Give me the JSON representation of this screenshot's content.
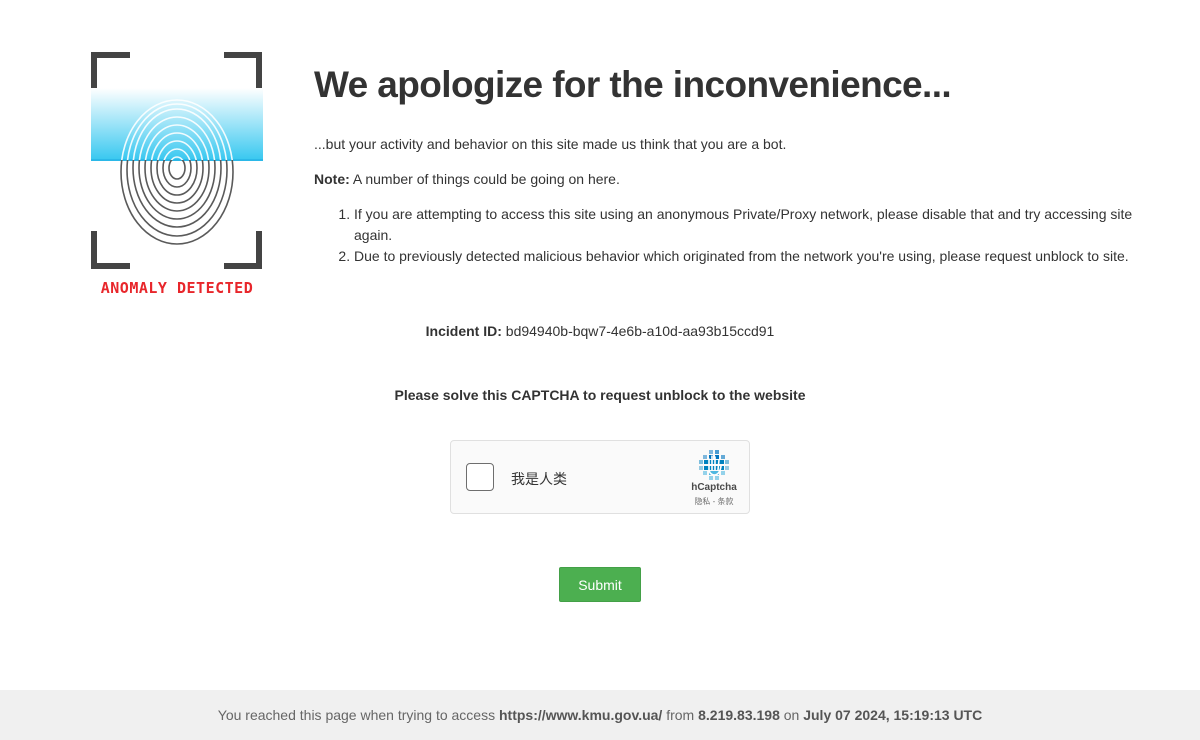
{
  "logo": {
    "caption": "ANOMALY DETECTED",
    "icon": "fingerprint-scan-icon",
    "caption_color": "#e8262b",
    "scan_color": "#38c8f0"
  },
  "heading": "We apologize for the inconvenience...",
  "lead": "...but your activity and behavior on this site made us think that you are a bot.",
  "note": {
    "label": "Note:",
    "text": " A number of things could be going on here."
  },
  "reasons": [
    "If you are attempting to access this site using an anonymous Private/Proxy network, please disable that and try accessing site again.",
    "Due to previously detected malicious behavior which originated from the network you're using, please request unblock to site."
  ],
  "incident": {
    "label": "Incident ID:",
    "value": " bd94940b-bqw7-4e6b-a10d-aa93b15ccd91"
  },
  "captcha_prompt": "Please solve this CAPTCHA to request unblock to the website",
  "hcaptcha": {
    "checkbox_label": "我是人类",
    "brand": "hCaptcha",
    "links": "隐私 - 条款",
    "icon": "hcaptcha-logo-icon"
  },
  "submit_label": "Submit",
  "footer": {
    "prefix": "You reached this page when trying to access ",
    "url": "https://www.kmu.gov.ua/",
    "from": " from ",
    "ip": "8.219.83.198",
    "on": " on ",
    "datetime": "July 07 2024, 15:19:13 UTC"
  },
  "colors": {
    "submit": "#4caf50",
    "footer_bg": "#f0f0f0"
  }
}
